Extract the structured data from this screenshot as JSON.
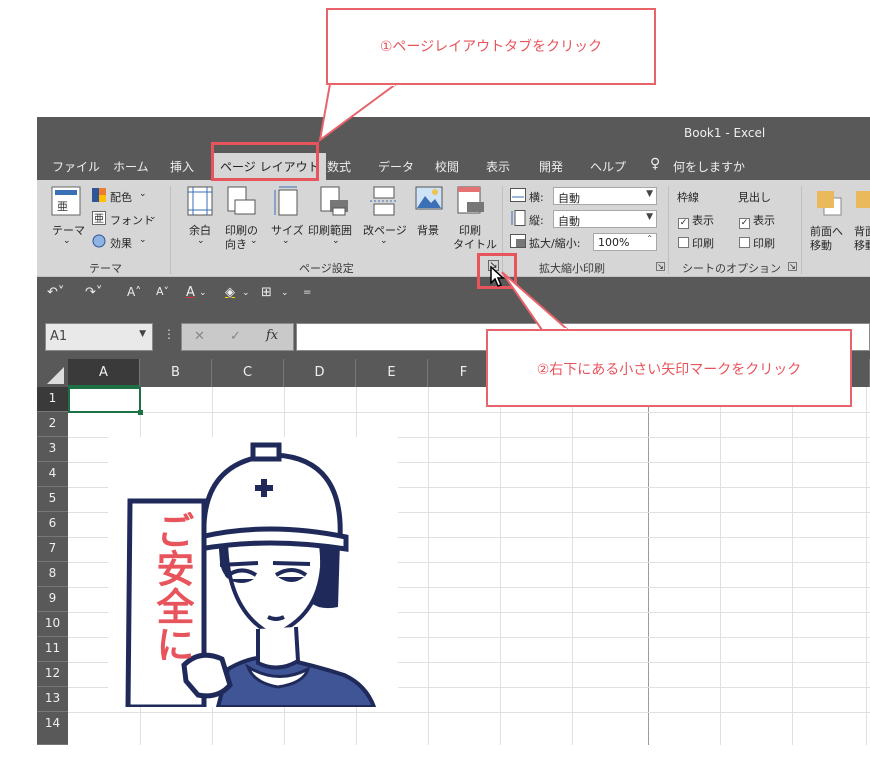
{
  "window": {
    "title": "Book1  -  Excel"
  },
  "tabs": [
    {
      "id": "file",
      "label": "ファイル"
    },
    {
      "id": "home",
      "label": "ホーム"
    },
    {
      "id": "insert",
      "label": "挿入"
    },
    {
      "id": "page_layout",
      "label": "ページ レイアウト",
      "active": true
    },
    {
      "id": "formulas",
      "label": "数式"
    },
    {
      "id": "data",
      "label": "データ"
    },
    {
      "id": "review",
      "label": "校閲"
    },
    {
      "id": "view",
      "label": "表示"
    },
    {
      "id": "developer",
      "label": "開発"
    },
    {
      "id": "help",
      "label": "ヘルプ"
    },
    {
      "id": "tell",
      "label": "何をしますか"
    }
  ],
  "ribbon": {
    "themes": {
      "group": "テーマ",
      "themes_btn": "テーマ",
      "colors": "配色",
      "fonts": "フォント",
      "effects": "効果"
    },
    "page_setup": {
      "group": "ページ設定",
      "margins": "余白",
      "orientation": "印刷の",
      "orientation2": "向き",
      "size": "サイズ",
      "print_area": "印刷範囲",
      "breaks": "改ページ",
      "background": "背景",
      "print_titles": "印刷",
      "print_titles2": "タイトル"
    },
    "scale": {
      "group": "拡大縮小印刷",
      "width_label": "横:",
      "width_value": "自動",
      "height_label": "縦:",
      "height_value": "自動",
      "scale_label": "拡大/縮小:",
      "scale_value": "100%"
    },
    "sheet_options": {
      "group": "シートのオプション",
      "gridlines": "枠線",
      "headings": "見出し",
      "view": "表示",
      "print": "印刷"
    },
    "arrange": {
      "bring_forward": "前面へ",
      "bring_forward2": "移動",
      "send_back": "背面",
      "send_back2": "移動"
    }
  },
  "formula_bar": {
    "name_box": "A1",
    "fx": "fx",
    "cancel": "✕",
    "enter": "✓"
  },
  "columns": [
    "A",
    "B",
    "C",
    "D",
    "E",
    "F"
  ],
  "rows": [
    "1",
    "2",
    "3",
    "4",
    "5",
    "6",
    "7",
    "8",
    "9",
    "10",
    "11",
    "12",
    "13",
    "14"
  ],
  "illustration": {
    "sign_text": "ご安全に"
  },
  "callouts": {
    "step1": "①ページレイアウトタブをクリック",
    "step2": "②右下にある小さい矢印マークをクリック"
  },
  "colors": {
    "accent": "#e8545c",
    "ribbon": "#d6d6d6",
    "dark": "#595959",
    "navy": "#1f2a5a",
    "excel_green": "#1e7145"
  }
}
